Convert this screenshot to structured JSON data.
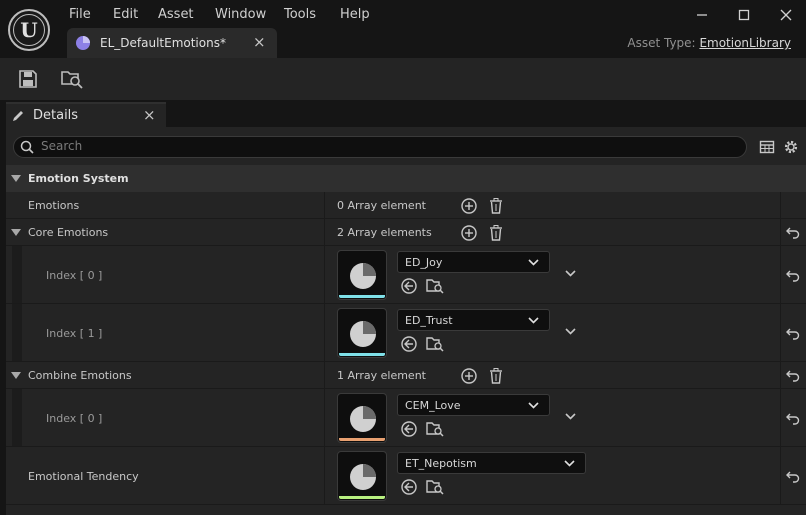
{
  "menu": [
    "File",
    "Edit",
    "Asset",
    "Window",
    "Tools",
    "Help"
  ],
  "tab": {
    "title": "EL_DefaultEmotions*",
    "close": "×"
  },
  "asset_type": {
    "label": "Asset Type:",
    "value": "EmotionLibrary"
  },
  "details": {
    "title": "Details",
    "close": "×"
  },
  "search": {
    "placeholder": "Search"
  },
  "category": "Emotion System",
  "rows": {
    "emotions": {
      "label": "Emotions",
      "value": "0 Array element"
    },
    "core": {
      "label": "Core Emotions",
      "value": "2 Array elements"
    },
    "core_items": [
      {
        "index": "Index [ 0 ]",
        "asset": "ED_Joy"
      },
      {
        "index": "Index [ 1 ]",
        "asset": "ED_Trust"
      }
    ],
    "combine": {
      "label": "Combine Emotions",
      "value": "1 Array element"
    },
    "combine_items": [
      {
        "index": "Index [ 0 ]",
        "asset": "CEM_Love"
      }
    ],
    "tendency": {
      "label": "Emotional Tendency",
      "asset": "ET_Nepotism"
    }
  },
  "colors": {
    "joy_bar": "#7fe0e8",
    "trust_bar": "#7fe0e8",
    "love_bar": "#e8a070",
    "nepotism_bar": "#b8f080",
    "accent": "#7b6cd9"
  },
  "icons": [
    "unreal-logo-icon",
    "asset-tab-icon",
    "save-icon",
    "browse-icon",
    "pencil-icon",
    "search-icon",
    "table-icon",
    "gear-icon",
    "add-icon",
    "trash-icon",
    "use-selected-icon",
    "browse-asset-icon",
    "reset-icon",
    "chevron-down-icon",
    "collapse-arrow-icon"
  ]
}
